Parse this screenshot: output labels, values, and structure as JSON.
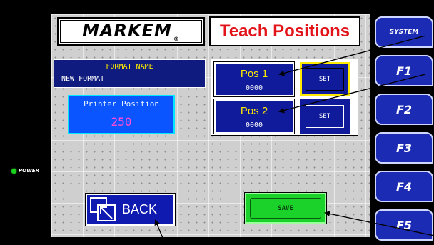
{
  "status": {
    "power_label": "POWER"
  },
  "header": {
    "logo_text": "MARKEM",
    "logo_mark": "®",
    "title": "Teach Positions"
  },
  "format": {
    "label": "FORMAT NAME",
    "value": "NEW FORMAT"
  },
  "printer_position": {
    "label": "Printer Position",
    "value": "250"
  },
  "positions": [
    {
      "label": "Pos 1",
      "value": "0000",
      "set_label": "SET"
    },
    {
      "label": "Pos 2",
      "value": "0000",
      "set_label": "SET"
    }
  ],
  "buttons": {
    "back_label": "BACK",
    "save_label": "SAVE"
  },
  "function_keys": [
    {
      "label": "SYSTEM"
    },
    {
      "label": "F1"
    },
    {
      "label": "F2"
    },
    {
      "label": "F3"
    },
    {
      "label": "F4"
    },
    {
      "label": "F5"
    }
  ],
  "colors": {
    "panel_blue": "#0f1b9a",
    "title_red": "#e2141a",
    "save_green": "#1ad22a",
    "highlight_yellow": "#ffea00"
  },
  "icons": {
    "back": "back-arrow-icon",
    "power": "power-led-icon"
  }
}
